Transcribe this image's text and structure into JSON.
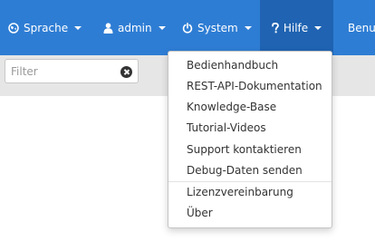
{
  "navbar": {
    "items": [
      {
        "label": "Sprache",
        "icon": "globe-icon"
      },
      {
        "label": "admin",
        "icon": "user-icon"
      },
      {
        "label": "System",
        "icon": "power-icon"
      },
      {
        "label": "Hilfe",
        "icon": "question-icon"
      },
      {
        "label": "Benut"
      }
    ]
  },
  "filter": {
    "placeholder": "Filter"
  },
  "help_menu": {
    "items": [
      "Bedienhandbuch",
      "REST-API-Dokumentation",
      "Knowledge-Base",
      "Tutorial-Videos",
      "Support kontaktieren",
      "Debug-Daten senden",
      "Lizenzvereinbarung",
      "Über"
    ]
  },
  "colors": {
    "navbar": "#2e7dd4",
    "navbar_active": "#1f63b2",
    "subbar": "#e6e6e6"
  }
}
